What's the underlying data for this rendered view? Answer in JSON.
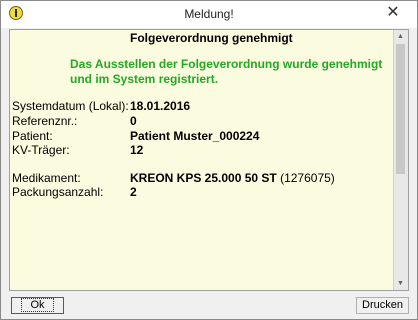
{
  "window": {
    "title": "Meldung!",
    "close_symbol": "✕",
    "icon": "info-exclamation-icon"
  },
  "content": {
    "heading": "Folgeverordnung genehmigt",
    "success_line1": "Das Ausstellen der Folgeverordnung wurde genehmigt",
    "success_line2": "und im System registriert.",
    "success_color": "#22aa22",
    "fields": [
      {
        "label": "Systemdatum (Lokal):",
        "value": "18.01.2016"
      },
      {
        "label": "Referenznr.:",
        "value": "0"
      },
      {
        "label": "Patient:",
        "value": "Patient Muster_000224"
      },
      {
        "label": "KV-Träger:",
        "value": "12"
      },
      {
        "label": "Medikament:",
        "value": "KREON KPS 25.000 50 ST",
        "code": "(1276075)"
      },
      {
        "label": "Packungsanzahl:",
        "value": "2"
      }
    ]
  },
  "buttons": {
    "ok": "Ok",
    "print": "Drucken"
  }
}
